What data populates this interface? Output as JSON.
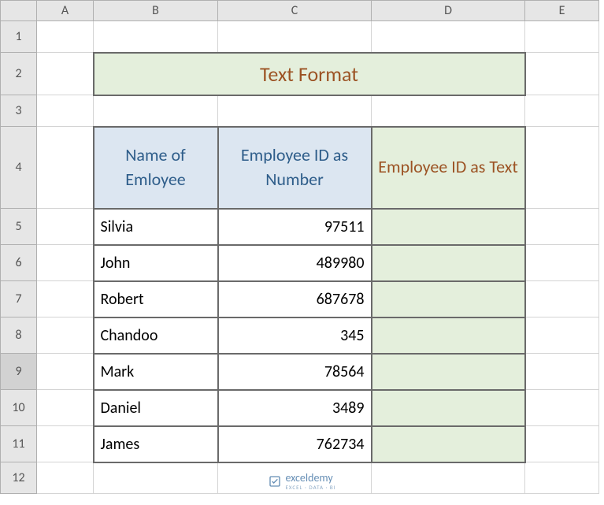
{
  "columns": {
    "A": "A",
    "B": "B",
    "C": "C",
    "D": "D",
    "E": "E"
  },
  "rows": {
    "r1": "1",
    "r2": "2",
    "r3": "3",
    "r4": "4",
    "r5": "5",
    "r6": "6",
    "r7": "7",
    "r8": "8",
    "r9": "9",
    "r10": "10",
    "r11": "11",
    "r12": "12"
  },
  "title": "Text Format",
  "headers": {
    "name": "Name of Emloyee",
    "id_num": "Employee ID as Number",
    "id_text": "Employee ID as Text"
  },
  "data": [
    {
      "name": "Silvia",
      "id": "97511",
      "id_text": ""
    },
    {
      "name": "John",
      "id": "489980",
      "id_text": ""
    },
    {
      "name": "Robert",
      "id": "687678",
      "id_text": ""
    },
    {
      "name": "Chandoo",
      "id": "345",
      "id_text": ""
    },
    {
      "name": "Mark",
      "id": "78564",
      "id_text": ""
    },
    {
      "name": "Daniel",
      "id": "3489",
      "id_text": ""
    },
    {
      "name": "James",
      "id": "762734",
      "id_text": ""
    }
  ],
  "watermark": {
    "brand": "exceldemy",
    "tag": "EXCEL · DATA · BI"
  },
  "chart_data": {
    "type": "table",
    "title": "Text Format",
    "columns": [
      "Name of Emloyee",
      "Employee ID as Number",
      "Employee ID as Text"
    ],
    "rows": [
      [
        "Silvia",
        97511,
        ""
      ],
      [
        "John",
        489980,
        ""
      ],
      [
        "Robert",
        687678,
        ""
      ],
      [
        "Chandoo",
        345,
        ""
      ],
      [
        "Mark",
        78564,
        ""
      ],
      [
        "Daniel",
        3489,
        ""
      ],
      [
        "James",
        762734,
        ""
      ]
    ]
  }
}
